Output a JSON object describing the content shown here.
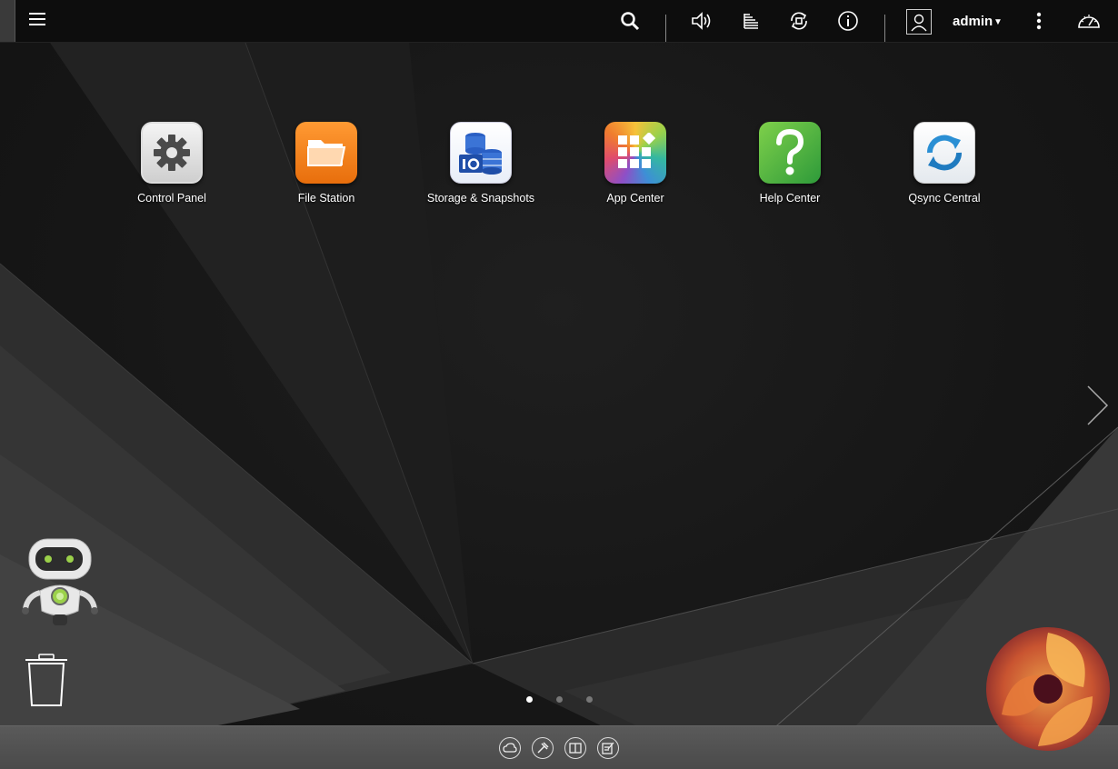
{
  "topbar": {
    "username": "admin"
  },
  "apps": [
    {
      "label": "Control Panel"
    },
    {
      "label": "File Station"
    },
    {
      "label": "Storage & Snapshots"
    },
    {
      "label": "App Center"
    },
    {
      "label": "Help Center"
    },
    {
      "label": "Qsync Central"
    }
  ],
  "pager": {
    "pages": 3,
    "current": 1
  },
  "colors": {
    "topbar": "#0d0d0d",
    "dock": "#555555",
    "file_station": "#f07d1e",
    "storage": "#2a5fc4",
    "help": "#3fa93a",
    "qsync": "#2a8fd4"
  }
}
